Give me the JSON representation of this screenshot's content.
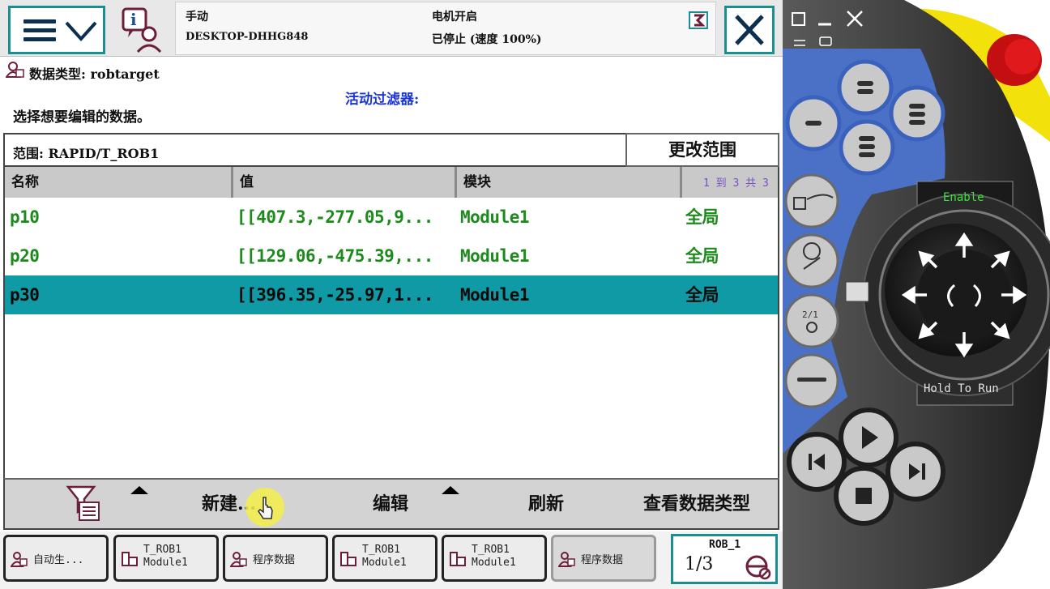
{
  "header": {
    "mode": "手动",
    "controller": "DESKTOP-DHHG848",
    "motor_state": "电机开启",
    "run_state": "已停止 (速度 100%)"
  },
  "datatype": {
    "label": "数据类型: robtarget"
  },
  "filter": {
    "label": "活动过滤器:"
  },
  "instruction": "选择想要编辑的数据。",
  "scope": {
    "label": "范围: RAPID/T_ROB1",
    "button": "更改范围"
  },
  "table": {
    "columns": [
      "名称",
      "值",
      "模块"
    ],
    "pager": "1 到 3 共 3",
    "rows": [
      {
        "name": "p10",
        "value": "[[407.3,-277.05,9...",
        "module": "Module1",
        "scope": "全局"
      },
      {
        "name": "p20",
        "value": "[[129.06,-475.39,...",
        "module": "Module1",
        "scope": "全局"
      },
      {
        "name": "p30",
        "value": "[[396.35,-25.97,1...",
        "module": "Module1",
        "scope": "全局"
      }
    ],
    "selected_index": 2
  },
  "toolbar": {
    "new": "新建...",
    "edit": "编辑",
    "refresh": "刷新",
    "view_types": "查看数据类型"
  },
  "taskbar": {
    "items": [
      {
        "line1": "自动生...",
        "icon": "data-icon"
      },
      {
        "line1": "T_ROB1",
        "line2": "Module1",
        "icon": "program-icon"
      },
      {
        "line1": "程序数据",
        "icon": "data-icon"
      },
      {
        "line1": "T_ROB1",
        "line2": "Module1",
        "icon": "program-icon"
      },
      {
        "line1": "T_ROB1",
        "line2": "Module1",
        "icon": "program-icon"
      },
      {
        "line1": "程序数据",
        "icon": "data-icon"
      }
    ],
    "robot": "ROB_1",
    "speed_fraction": "1/3"
  },
  "pendant": {
    "enable_label": "Enable",
    "hold_to_run_label": "Hold To Run"
  },
  "colors": {
    "accent": "#1b8f8f",
    "selected_row": "#0f9aa6",
    "value_text": "#1c8a1c",
    "filter_text": "#1a35d8"
  }
}
